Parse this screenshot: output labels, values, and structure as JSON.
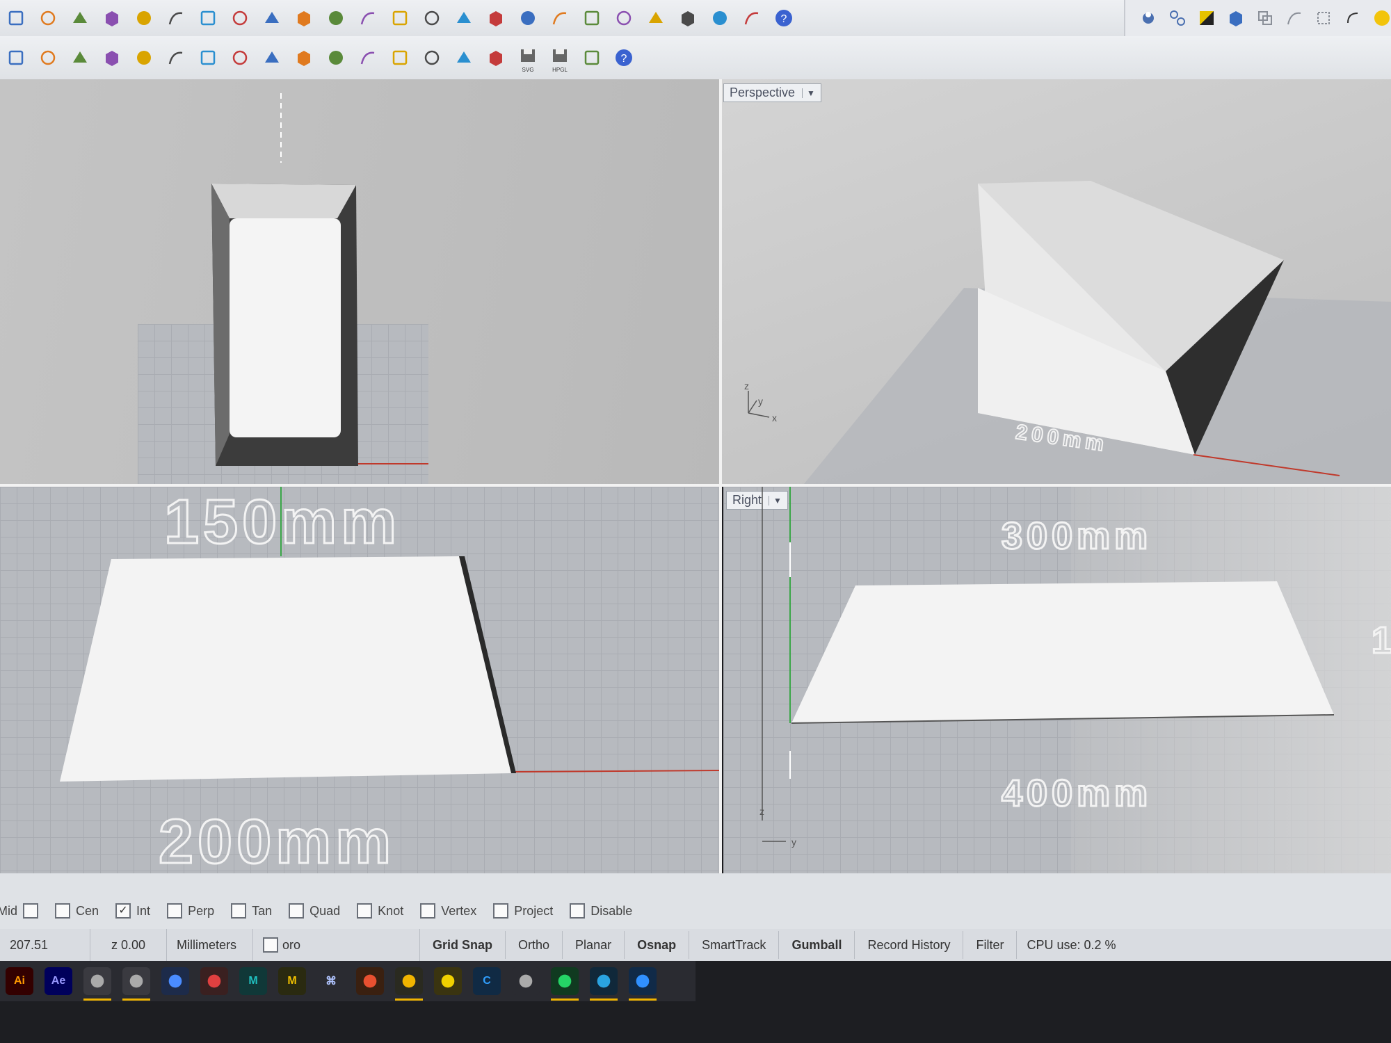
{
  "viewports": {
    "perspective_label": "Perspective",
    "right_label": "Right"
  },
  "axis_labels": {
    "z": "z",
    "y": "y",
    "x": "x"
  },
  "dimensions": {
    "top_150": "150mm",
    "top_200": "200mm",
    "persp_200": "200mm",
    "right_300": "300mm",
    "right_400": "400mm",
    "right_edge": "1"
  },
  "osnaps": [
    {
      "label": "Mid",
      "checked": false
    },
    {
      "label": "Cen",
      "checked": false
    },
    {
      "label": "Int",
      "checked": true
    },
    {
      "label": "Perp",
      "checked": false
    },
    {
      "label": "Tan",
      "checked": false
    },
    {
      "label": "Quad",
      "checked": false
    },
    {
      "label": "Knot",
      "checked": false
    },
    {
      "label": "Vertex",
      "checked": false
    },
    {
      "label": "Project",
      "checked": false
    },
    {
      "label": "Disable",
      "checked": false
    }
  ],
  "status": {
    "coord_x": "207.51",
    "coord_z": "z 0.00",
    "units": "Millimeters",
    "layer": "oro",
    "panes": [
      "Grid Snap",
      "Ortho",
      "Planar",
      "Osnap",
      "SmartTrack",
      "Gumball",
      "Record History",
      "Filter"
    ],
    "bold_panes": [
      "Grid Snap",
      "Osnap",
      "Gumball"
    ],
    "cpu": "CPU use: 0.2 %"
  },
  "toolbar_icons_row1": [
    "new-icon",
    "undo-icon",
    "pan-icon",
    "move-icon",
    "zoom-icon",
    "zoom-window-icon",
    "zoom-extents-icon",
    "zoom-selected-icon",
    "zoom-realtime-icon",
    "viewport-layout-icon",
    "car-icon",
    "snap-icon",
    "circle-select-icon",
    "select-icon",
    "bulb-icon",
    "lock-icon",
    "box-icon",
    "color-wheel-icon",
    "shade-icon",
    "rendered-icon",
    "sphere-icon",
    "pointer-icon",
    "gear-icon",
    "dimension-icon",
    "help-icon"
  ],
  "toolbar_icons_row2": [
    "cut-icon",
    "bird-icon",
    "planes-icon",
    "cube-icon",
    "star-icon",
    "curve-icon",
    "arc-icon",
    "check-icon",
    "crystal-icon",
    "folders-icon",
    "wrench-icon",
    "frame-icon",
    "grid-icon",
    "paint-icon",
    "bold-icon",
    "frame-dashed-icon",
    "save-svg-icon",
    "save-hpgl-icon",
    "open-folder-icon",
    "help-icon"
  ],
  "save_svg_label": "SVG",
  "save_hpgl_label": "HPGL",
  "taskbar": {
    "apps": [
      {
        "name": "illustrator-icon",
        "label": "Ai",
        "color": "#ff9a00",
        "bg": "#330000"
      },
      {
        "name": "after-effects-icon",
        "label": "Ae",
        "color": "#9999ff",
        "bg": "#00005b"
      },
      {
        "name": "rhino-icon",
        "label": "",
        "color": "#aaaaaa",
        "bg": "#3a3a40"
      },
      {
        "name": "photos-icon",
        "label": "",
        "color": "#aaaaaa",
        "bg": "#3a3a40"
      },
      {
        "name": "browser-icon",
        "label": "",
        "color": "#4a8cff",
        "bg": "#1d2b4a"
      },
      {
        "name": "security-icon",
        "label": "",
        "color": "#e04040",
        "bg": "#3a2020"
      },
      {
        "name": "meet-icon",
        "label": "M",
        "color": "#20c0c0",
        "bg": "#103838"
      },
      {
        "name": "gmail-icon",
        "label": "M",
        "color": "#f0c000",
        "bg": "#2a2a10"
      },
      {
        "name": "command-icon",
        "label": "⌘",
        "color": "#b0c4ff",
        "bg": "#2a2b31"
      },
      {
        "name": "calendar-icon",
        "label": "",
        "color": "#e85030",
        "bg": "#3a2010"
      },
      {
        "name": "chrome-icon",
        "label": "",
        "color": "#f0b400",
        "bg": "#2a2a20"
      },
      {
        "name": "notes-icon",
        "label": "",
        "color": "#f0d000",
        "bg": "#3a3410"
      },
      {
        "name": "c-app-icon",
        "label": "C",
        "color": "#30a0ff",
        "bg": "#102a44"
      },
      {
        "name": "pen-icon",
        "label": "",
        "color": "#aaaaaa",
        "bg": "#2a2b31"
      },
      {
        "name": "whatsapp-icon",
        "label": "",
        "color": "#25d366",
        "bg": "#103a20"
      },
      {
        "name": "telegram-icon",
        "label": "",
        "color": "#2aa3e0",
        "bg": "#10283a"
      },
      {
        "name": "photo-app-icon",
        "label": "",
        "color": "#3090ff",
        "bg": "#102a48"
      }
    ],
    "active": [
      "rhino-icon",
      "photos-icon",
      "chrome-icon",
      "whatsapp-icon",
      "telegram-icon",
      "photo-app-icon"
    ]
  }
}
